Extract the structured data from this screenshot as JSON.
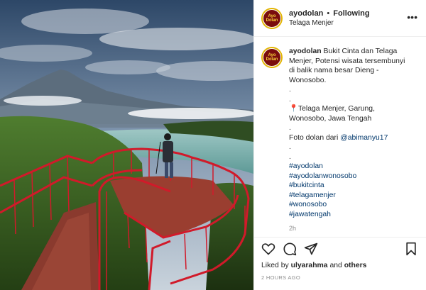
{
  "header": {
    "avatar_text": "Ayo Dolan",
    "username": "ayodolan",
    "separator": "•",
    "follow_status": "Following",
    "location": "Telaga Menjer"
  },
  "caption": {
    "username": "ayodolan",
    "lines": [
      "Bukit Cinta dan Telaga",
      "Menjer, Potensi wisata tersembunyi",
      "di balik nama besar Dieng -",
      "Wonosobo.",
      ".",
      ".",
      "Telaga Menjer, Garung,",
      "Wonosobo, Jawa Tengah",
      ".",
      "Foto dolan dari ",
      ".",
      "."
    ],
    "mention": "@abimanyu17",
    "hashtags": [
      "#ayodolan",
      "#ayodolanwonosobo",
      "#bukitcinta",
      "#telagamenjer",
      "#wonosobo",
      "#jawatengah"
    ],
    "relative_time": "2h"
  },
  "actions": {
    "like": "heart-icon",
    "comment": "comment-icon",
    "share": "share-icon",
    "save": "bookmark-icon"
  },
  "likes": {
    "prefix": "Liked by ",
    "user": "ulyarahma",
    "middle": " and ",
    "others": "others"
  },
  "timestamp": "2 HOURS AGO",
  "colors": {
    "rail_red": "#d11a2a",
    "link": "#00376b",
    "muted": "#8e8e8e"
  }
}
